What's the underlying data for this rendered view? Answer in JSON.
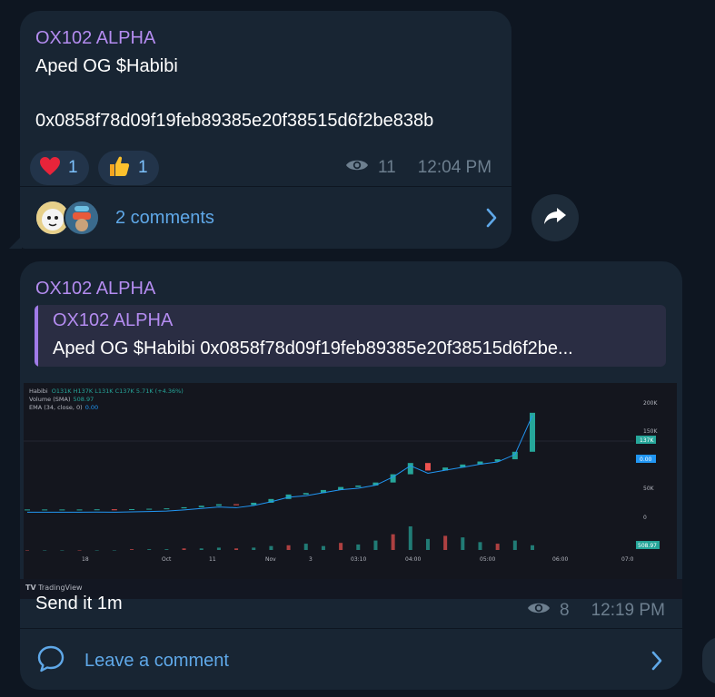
{
  "messages": [
    {
      "sender": "OX102 ALPHA",
      "line1": "Aped OG $Habibi",
      "line2": "0x0858f78d09f19feb89385e20f38515d6f2be838b",
      "reactions": [
        {
          "emoji": "❤️",
          "icon": "heart-icon",
          "count": "1"
        },
        {
          "emoji": "👍",
          "icon": "thumbs-up-icon",
          "count": "1"
        }
      ],
      "views": "11",
      "time": "12:04 PM",
      "comments_label": "2 comments"
    },
    {
      "sender": "OX102 ALPHA",
      "quote": {
        "sender": "OX102 ALPHA",
        "text": "Aped OG $Habibi  0x0858f78d09f19feb89385e20f38515d6f2be..."
      },
      "text": "Send it 1m",
      "views": "8",
      "time": "12:19 PM",
      "comment_label": "Leave a comment"
    }
  ],
  "chart_data": {
    "type": "line",
    "legend": {
      "symbol": "Habibi",
      "ohlc": "O131K H137K L131K C137K 5.71K (+4.36%)",
      "volume_label": "Volume (SMA)",
      "volume_value": "508.97",
      "ema_label": "EMA (34, close, 0)",
      "ema_value": "0.00"
    },
    "x_ticks": [
      "18",
      "Oct",
      "11",
      "Nov",
      "3",
      "03:10",
      "04:00",
      "05:00",
      "06:00",
      "07:0"
    ],
    "y_ticks": [
      "200K",
      "150K",
      "50K",
      "0"
    ],
    "price_tag": "137K",
    "ema_tag": "0.00",
    "volume_tag": "508.97",
    "watermark": "TradingView",
    "price_series": [
      8,
      8,
      8,
      8,
      8.2,
      8,
      8.5,
      9,
      9.5,
      11,
      13,
      15,
      14,
      17,
      22,
      28,
      30,
      34,
      38,
      40,
      44,
      55,
      70,
      60,
      64,
      68,
      72,
      75,
      85,
      137
    ],
    "volume_series": [
      0,
      0,
      0,
      0,
      0,
      0,
      1,
      1,
      1,
      2,
      2,
      3,
      2,
      3,
      5,
      6,
      8,
      5,
      9,
      7,
      12,
      20,
      30,
      14,
      18,
      16,
      10,
      8,
      12,
      6
    ],
    "colors": {
      "up": "#26a69a",
      "down": "#ef5350",
      "ema": "#2196f3"
    }
  }
}
